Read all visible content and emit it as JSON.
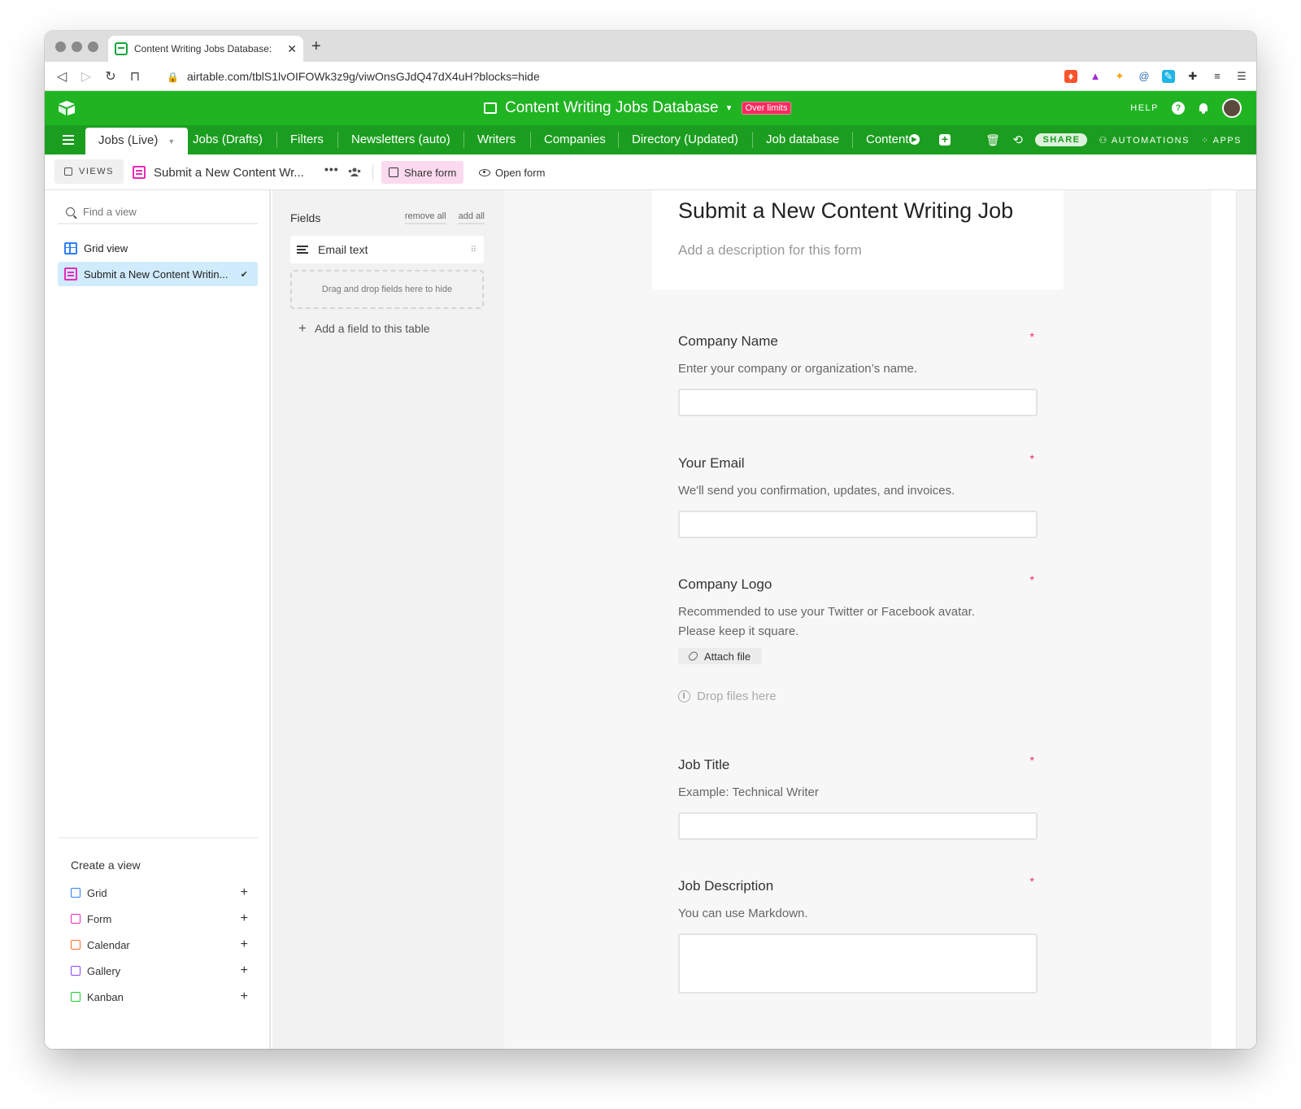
{
  "browser": {
    "tab_title": "Content Writing Jobs Database:",
    "tab_close": "✕",
    "new_tab": "+",
    "url": "airtable.com/tblS1lvOIFOWk3z9g/viwOnsGJdQ47dX4uH?blocks=hide"
  },
  "header": {
    "base_title": "Content Writing Jobs Database",
    "caret": "▼",
    "over_limits": "Over limits",
    "help": "HELP",
    "help_symbol": "?"
  },
  "table_tabs": [
    {
      "label": "Jobs (Live)",
      "active": true
    },
    {
      "label": "Jobs (Drafts)"
    },
    {
      "label": "Filters"
    },
    {
      "label": "Newsletters (auto)"
    },
    {
      "label": "Writers"
    },
    {
      "label": "Companies"
    },
    {
      "label": "Directory (Updated)"
    },
    {
      "label": "Job database"
    },
    {
      "label": "Content"
    }
  ],
  "table_bar_right": {
    "share": "SHARE",
    "automations": "AUTOMATIONS",
    "apps": "APPS"
  },
  "viewbar": {
    "views_label": "VIEWS",
    "view_name": "Submit a New Content Wr...",
    "more": "•••",
    "share_form": "Share form",
    "open_form": "Open form"
  },
  "sidebar": {
    "search_placeholder": "Find a view",
    "views": [
      {
        "label": "Grid view",
        "type": "grid"
      },
      {
        "label": "Submit a New Content Writin...",
        "type": "form",
        "selected": true,
        "check": "✔"
      }
    ],
    "create_title": "Create a view",
    "create_items": [
      {
        "label": "Grid",
        "color": "#2d7ff9"
      },
      {
        "label": "Form",
        "color": "#e929ba"
      },
      {
        "label": "Calendar",
        "color": "#ff6f2c"
      },
      {
        "label": "Gallery",
        "color": "#8b46ff"
      },
      {
        "label": "Kanban",
        "color": "#20c933"
      }
    ],
    "plus": "+"
  },
  "fields_panel": {
    "title": "Fields",
    "remove_all": "remove all",
    "add_all": "add all",
    "hidden_field": "Email text",
    "drag_handle": "⠿",
    "drop_hint": "Drag and drop fields here to hide",
    "add_field": "Add a field to this table",
    "plus": "+"
  },
  "form": {
    "title": "Submit a New Content Writing Job",
    "description_placeholder": "Add a description for this form",
    "required_mark": "*",
    "fields": [
      {
        "label": "Company Name",
        "help": "Enter your company or organization’s name.",
        "type": "text"
      },
      {
        "label": "Your Email",
        "help": "We'll send you confirmation, updates, and invoices.",
        "type": "text"
      },
      {
        "label": "Company Logo",
        "help_lines": [
          "Recommended to use your Twitter or Facebook avatar.",
          "Please keep it square."
        ],
        "type": "attachment",
        "attach_label": "Attach file",
        "drop_label": "Drop files here"
      },
      {
        "label": "Job Title",
        "help": "Example: Technical Writer",
        "type": "text"
      },
      {
        "label": "Job Description",
        "help": "You can use Markdown.",
        "type": "longtext"
      }
    ]
  },
  "colors": {
    "header_green": "#20b423",
    "tabs_green": "#1b9e1f",
    "form_pink": "#e929ba",
    "required_red": "#e9266c",
    "over_limits": "#f82b60"
  }
}
